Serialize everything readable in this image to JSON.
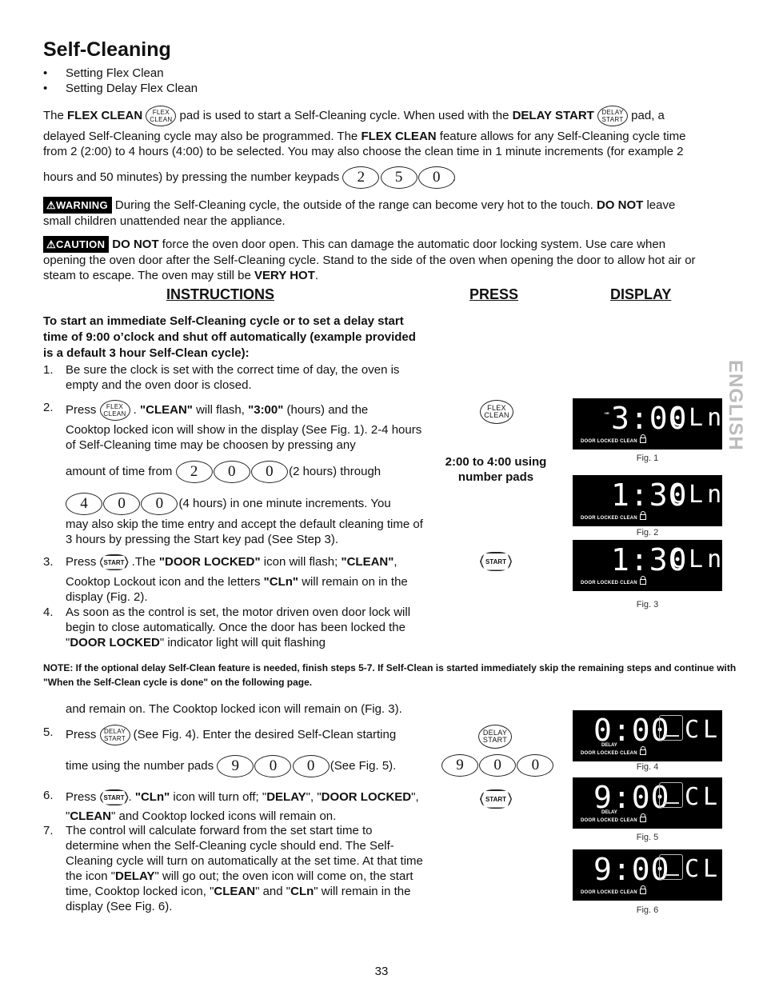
{
  "title": "Self-Cleaning",
  "bullets": [
    "Setting Flex Clean",
    "Setting Delay Flex Clean"
  ],
  "intro": {
    "p1_a": "The ",
    "p1_b": "FLEX CLEAN",
    "p1_c": " pad is used to start a Self-Cleaning cycle. When used with the ",
    "p1_d": "DELAY START",
    "p1_e": " pad, a",
    "p2_a": "delayed Self-Cleaning cycle may also be programmed.  The ",
    "p2_b": "FLEX CLEAN",
    "p2_c": " feature allows for any Self-Cleaning cycle time",
    "p3": "from 2 (2:00) to 4 hours (4:00) to be selected. You may also choose the clean time in 1 minute increments (for example 2",
    "p4": "hours and 50 minutes) by pressing the number keypads",
    "p4_keys": [
      "2",
      "5",
      "0"
    ],
    "p4_end": "."
  },
  "keypads": {
    "flex_clean": [
      "FLEX",
      "CLEAN"
    ],
    "delay_start": [
      "DELAY",
      "START"
    ],
    "start": "START"
  },
  "warning": {
    "label": "WARNING",
    "text_a": "During the Self-Cleaning cycle, the outside of the range can become very hot to the touch. ",
    "text_b": "DO NOT",
    "text_c": " leave",
    "text_d": "small children unattended near the appliance."
  },
  "caution": {
    "label": "CAUTION",
    "text_a": "DO NOT",
    "text_b": " force the oven door open. This can damage the automatic door locking system. Use care when",
    "text_c": "opening the oven door after the Self-Cleaning cycle. Stand to the side of the oven when opening the door to allow hot air or",
    "text_d": "steam to escape.  The oven may still be ",
    "text_e": "VERY HOT",
    "text_f": "."
  },
  "headings": {
    "instructions": "INSTRUCTIONS",
    "press": "PRESS",
    "display": "DISPLAY"
  },
  "instructions_intro": "To start an immediate Self-Cleaning cycle or to set a delay start time of 9:00 o’clock and shut off automatically (example provided is a default 3 hour Self-Clean cycle):",
  "steps": {
    "s1": {
      "n": "1.",
      "text": "Be sure the clock is set with the correct time of day, the oven is empty and the oven door is closed."
    },
    "s2": {
      "n": "2.",
      "a": "Press ",
      "b": " . ",
      "c": "\"CLEAN\"",
      "d": " will flash, ",
      "e": "\"3:00\"",
      "f": " (hours) and the",
      "g": "Cooktop locked icon will show in the display (See Fig. 1). 2-4 hours of Self-Cleaning time may be choosen by pressing any",
      "h": "amount of time from",
      "keys1": [
        "2",
        "0",
        "0"
      ],
      "i": "(2 hours) through",
      "keys2": [
        "4",
        "0",
        "0"
      ],
      "j": "(4 hours) in one minute increments. You",
      "k": "may also skip the time entry and accept the default cleaning time of 3 hours by pressing the Start key pad (See Step 3)."
    },
    "s3": {
      "n": "3.",
      "a": "Press ",
      "b": " .The ",
      "c": "\"DOOR LOCKED\"",
      "d": " icon will flash; ",
      "e": "\"CLEAN\"",
      "f": ",",
      "g": "Cooktop Lockout icon and the letters ",
      "h": "\"CLn\"",
      "i": " will remain on in the display (Fig. 2)."
    },
    "s4": {
      "n": "4.",
      "a": "As soon as the control is set, the motor driven oven door lock will begin to close automatically. Once the door has been locked the \"",
      "b": "DOOR LOCKED",
      "c": "\" indicator light will quit flashing"
    },
    "note": "NOTE: If the optional delay Self-Clean feature is needed, finish steps 5-7. If Self-Clean is started immediately skip the remaining steps and continue with \"When the Self-Clean cycle is done\" on the following page.",
    "s4_cont": "and remain on. The Cooktop locked icon will remain on (Fig. 3).",
    "s5": {
      "n": "5.",
      "a": "Press ",
      "b": " (See Fig. 4).  Enter the desired Self-Clean starting",
      "c": "time using the number pads",
      "keys": [
        "9",
        "0",
        "0"
      ],
      "d": "(See Fig. 5)."
    },
    "s6": {
      "n": "6.",
      "a": "Press ",
      "b": ". ",
      "c": "\"CLn\"",
      "d": " icon will turn off; \"",
      "e": "DELAY",
      "f": "\", \"",
      "g": "DOOR LOCKED",
      "h": "\",  \"",
      "i": "CLEAN",
      "j": "\" and Cooktop locked icons will remain on."
    },
    "s7": {
      "n": "7.",
      "a": "The control will calculate forward from the set start time to determine when the Self-Cleaning cycle should end. The Self-Cleaning cycle will turn on automatically at the set time. At that time the icon \"",
      "b": "DELAY",
      "c": "\" will go out; the oven icon will come on, the start time, Cooktop locked icon, \"",
      "d": "CLEAN",
      "e": "\" and \"",
      "f": "CLn",
      "g": "\" will remain  in the display (See Fig. 6)."
    }
  },
  "press_column": {
    "range_text": "2:00 to 4:00 using number pads",
    "delay_keys": [
      "9",
      "0",
      "0"
    ]
  },
  "displays": [
    {
      "time": "3:00",
      "hr": "HR",
      "mode": "CLn",
      "status": "DOOR LOCKED CLEAN",
      "caption": "Fig. 1"
    },
    {
      "time": "1:30",
      "mode": "CLn",
      "status": "DOOR LOCKED CLEAN",
      "caption": "Fig. 2"
    },
    {
      "time": "1:30",
      "mode": "CLn",
      "status": "DOOR LOCKED CLEAN",
      "caption": "Fig. 3"
    },
    {
      "time": "0:00",
      "mode": "CLn",
      "delay": "DELAY",
      "status": "DOOR LOCKED CLEAN",
      "caption": "Fig. 4"
    },
    {
      "time": "9:00",
      "mode": "CLn",
      "delay": "DELAY",
      "status": "DOOR LOCKED CLEAN",
      "caption": "Fig. 5"
    },
    {
      "time": "9:00",
      "mode": "CLn",
      "status": "DOOR LOCKED CLEAN",
      "caption": "Fig. 6"
    }
  ],
  "side_tab": "ENGLISH",
  "page_number": "33"
}
